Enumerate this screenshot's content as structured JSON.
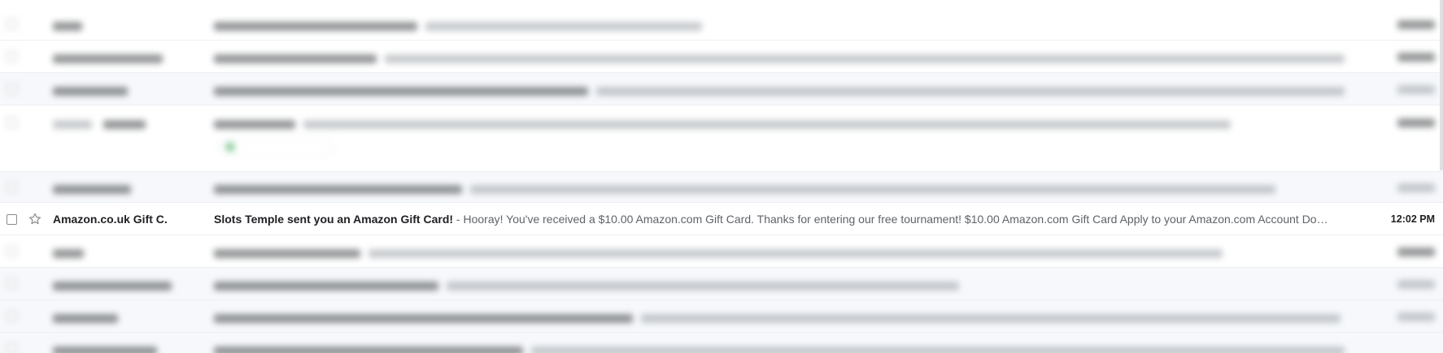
{
  "highlighted_email": {
    "sender": "Amazon.co.uk Gift C.",
    "subject": "Slots Temple sent you an Amazon Gift Card!",
    "separator": " - ",
    "snippet": "Hooray! You've received a $10.00 Amazon.com Gift Card. Thanks for entering our free tournament! $10.00 Amazon.com Gift Card Apply to your Amazon.com Account Do…",
    "time": "12:02 PM",
    "star_icon": "star-outline-icon",
    "checkbox_icon": "checkbox-icon"
  },
  "colors": {
    "text_primary": "#202124",
    "text_secondary": "#5f6368",
    "read_row_background": "#f6f8fb",
    "divider": "#eceff1",
    "chip_icon": "#34a853"
  }
}
